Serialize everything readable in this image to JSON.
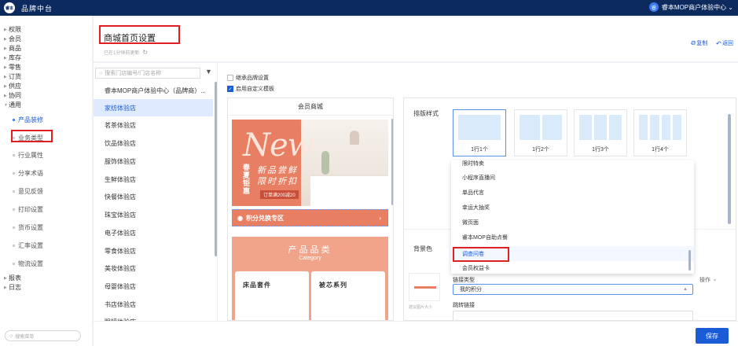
{
  "topbar": {
    "brand": "品牌中台",
    "logo_text": "睿本",
    "user_avatar": "睿",
    "user_name": "睿本MOP商户体验中心 ⌄"
  },
  "sidebar": {
    "groups": [
      {
        "label": "权限"
      },
      {
        "label": "会员"
      },
      {
        "label": "商品"
      },
      {
        "label": "库存"
      },
      {
        "label": "零售"
      },
      {
        "label": "订货"
      },
      {
        "label": "供应"
      },
      {
        "label": "协同"
      },
      {
        "label": "通用"
      }
    ],
    "sub_items": [
      {
        "label": "产品装修"
      },
      {
        "label": "业务类型"
      },
      {
        "label": "行业属性"
      },
      {
        "label": "分享术语"
      },
      {
        "label": "意见反馈"
      },
      {
        "label": "打印设置"
      },
      {
        "label": "货币设置"
      },
      {
        "label": "汇率设置"
      },
      {
        "label": "物流设置"
      }
    ],
    "tail_groups": [
      {
        "label": "报表"
      },
      {
        "label": "日志"
      }
    ],
    "search_placeholder": "搜索菜单"
  },
  "header": {
    "title": "商城首页设置",
    "subtitle": "已在1分钟前更新",
    "copy_label": "复制",
    "back_label": "返回"
  },
  "stores": {
    "search_placeholder": "搜索门店编号/门店名称",
    "items": [
      "睿本MOP商户体验中心（品牌商）...",
      "家纺体验店",
      "茗茶体验店",
      "饮品体验店",
      "服饰体验店",
      "生鲜体验店",
      "快餐体验店",
      "珠宝体验店",
      "电子体验店",
      "零食体验店",
      "美妆体验店",
      "母婴体验店",
      "书店体验店",
      "眼镜体验店"
    ],
    "active_index": 1
  },
  "settings": {
    "inherit_label": "继承品牌设置",
    "custom_label": "启用自定义模板",
    "inherit_checked": false,
    "custom_checked": true
  },
  "preview": {
    "title": "会员商城",
    "banner": {
      "new_text": "New",
      "season": "春夏钜惠",
      "slogan1": "新品尝鲜",
      "slogan2": "限时折扣",
      "coupon": "订单满200减20"
    },
    "points_label": "积分兑换专区",
    "category_title": "产品品类",
    "category_sub": "Category",
    "cards": [
      "床品套件",
      "被芯系列"
    ]
  },
  "config": {
    "layout_label": "排版样式",
    "layouts": [
      {
        "label": "1行1个",
        "cols": 1
      },
      {
        "label": "1行2个",
        "cols": 2
      },
      {
        "label": "1行3个",
        "cols": 3
      },
      {
        "label": "1行4个",
        "cols": 4
      }
    ],
    "selected_layout": 0,
    "bg_label": "背景色",
    "link_type_label": "链接类型",
    "link_value": "我的积分",
    "jump_label": "跳转链接",
    "thumb_caption": "建议图片大小",
    "op_label": "操作"
  },
  "dropdown": {
    "options": [
      "限时特卖",
      "小程序直播间",
      "单品代言",
      "幸运大抽奖",
      "微页面",
      "睿本MOP自助点餐",
      "调查问卷",
      "会员权益卡"
    ],
    "highlighted_index": 6
  },
  "footer": {
    "save_label": "保存"
  },
  "colors": {
    "accent": "#1a5cd6",
    "topbar": "#0c2a5e",
    "banner": "#e87f63",
    "highlight_red": "#e02020"
  }
}
